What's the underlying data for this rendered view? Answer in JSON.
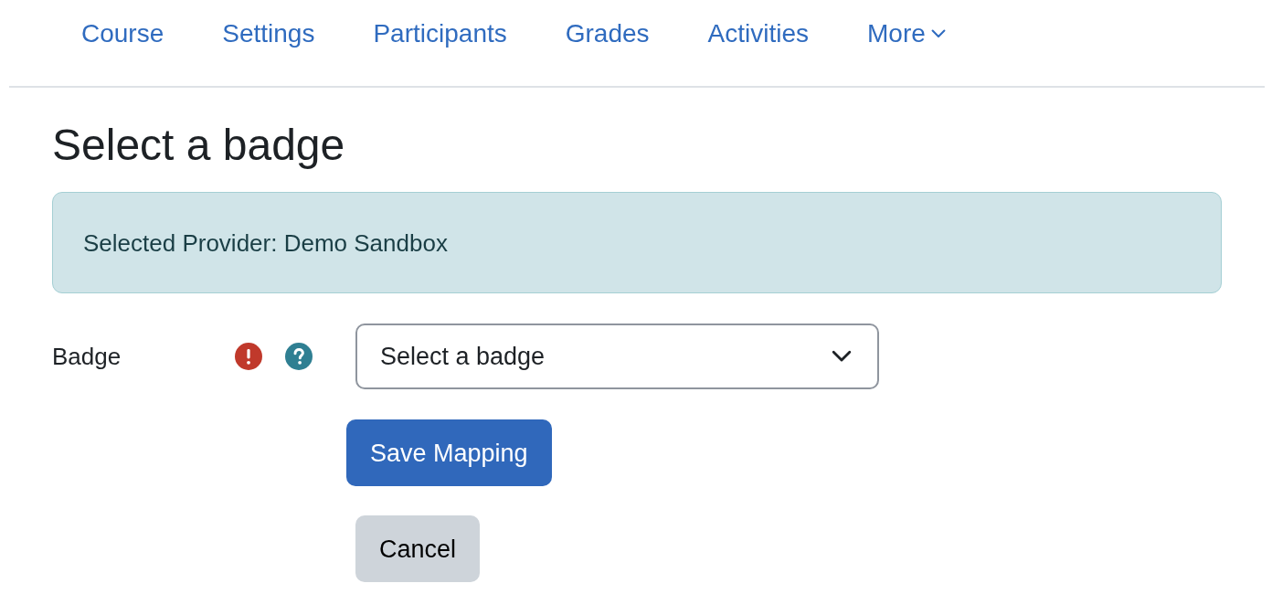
{
  "nav": {
    "tabs": [
      {
        "label": "Course",
        "selected": false
      },
      {
        "label": "Settings",
        "selected": false
      },
      {
        "label": "Participants",
        "selected": false
      },
      {
        "label": "Grades",
        "selected": false
      },
      {
        "label": "Activities",
        "selected": false
      },
      {
        "label": "More",
        "selected": false,
        "kind": "dropdown"
      }
    ]
  },
  "heading": "Select a badge",
  "alert": {
    "text": "Selected Provider: Demo Sandbox"
  },
  "field": {
    "label": "Badge",
    "required": true,
    "help": true,
    "select": {
      "value": "Select a badge"
    }
  },
  "buttons": [
    {
      "label": "Save Mapping",
      "kind": "primary"
    },
    {
      "label": "Cancel",
      "kind": "secondary"
    }
  ]
}
